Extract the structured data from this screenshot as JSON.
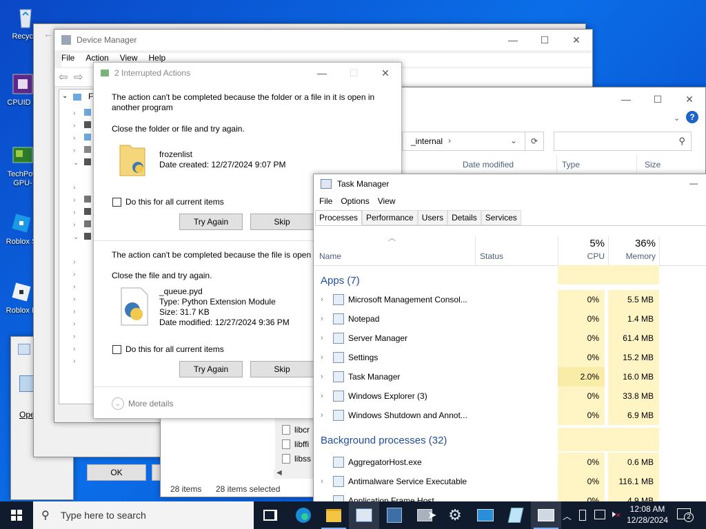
{
  "desktop": {
    "icons": [
      {
        "label": "Recycle",
        "icon": "recycle-bin-icon"
      },
      {
        "label": "CPUID C",
        "icon": "cpuid-icon"
      },
      {
        "label": "TechPow GPU-",
        "icon": "gpu-card-icon"
      },
      {
        "label": "Roblox S",
        "icon": "roblox-icon"
      },
      {
        "label": "Roblox P",
        "icon": "roblox-icon"
      }
    ]
  },
  "bg_window": {
    "open_label": "Ope"
  },
  "properties_window": {
    "ok_label": "OK"
  },
  "device_manager": {
    "title": "Device Manager",
    "menu": [
      "File",
      "Action",
      "View",
      "Help"
    ],
    "tree_root_letter": "F"
  },
  "explorer": {
    "path_text": "_internal",
    "search_placeholder": "",
    "columns": [
      "Date modified",
      "Type",
      "Size"
    ],
    "files": [
      "libcr",
      "libffi",
      "libss"
    ],
    "status_items": "28 items",
    "status_selected": "28 items selected"
  },
  "interrupted_dialog": {
    "title": "2 Interrupted Actions",
    "item1": {
      "message": "The action can't be completed because the folder or a file in it is open in another program",
      "instruction": "Close the folder or file and try again.",
      "name": "frozenlist",
      "detail1": "Date created: 12/27/2024 9:07 PM",
      "checkbox": "Do this for all current items",
      "try_again": "Try Again",
      "skip": "Skip"
    },
    "item2": {
      "message": "The action can't be completed because the file is open i",
      "instruction": "Close the file and try again.",
      "name": "_queue.pyd",
      "detail1": "Type: Python Extension Module",
      "detail2": "Size: 31.7 KB",
      "detail3": "Date modified: 12/27/2024 9:36 PM",
      "checkbox": "Do this for all current items",
      "try_again": "Try Again",
      "skip": "Skip"
    },
    "more_details": "More details"
  },
  "task_manager": {
    "title": "Task Manager",
    "menu": [
      "File",
      "Options",
      "View"
    ],
    "tabs": [
      "Processes",
      "Performance",
      "Users",
      "Details",
      "Services"
    ],
    "col_name": "Name",
    "col_status": "Status",
    "cpu_pct": "5%",
    "cpu_label": "CPU",
    "mem_pct": "36%",
    "mem_label": "Memory",
    "apps_header": "Apps (7)",
    "bg_header": "Background processes (32)",
    "apps": [
      {
        "name": "Microsoft Management Consol...",
        "cpu": "0%",
        "mem": "5.5 MB",
        "icon": "mmc-icon"
      },
      {
        "name": "Notepad",
        "cpu": "0%",
        "mem": "1.4 MB",
        "icon": "notepad-icon"
      },
      {
        "name": "Server Manager",
        "cpu": "0%",
        "mem": "61.4 MB",
        "icon": "server-manager-icon"
      },
      {
        "name": "Settings",
        "cpu": "0%",
        "mem": "15.2 MB",
        "icon": "settings-icon"
      },
      {
        "name": "Task Manager",
        "cpu": "2.0%",
        "mem": "16.0 MB",
        "icon": "task-manager-icon"
      },
      {
        "name": "Windows Explorer (3)",
        "cpu": "0%",
        "mem": "33.8 MB",
        "icon": "explorer-icon"
      },
      {
        "name": "Windows Shutdown and Annot...",
        "cpu": "0%",
        "mem": "6.9 MB",
        "icon": "shutdown-icon"
      }
    ],
    "bg": [
      {
        "name": "AggregatorHost.exe",
        "cpu": "0%",
        "mem": "0.6 MB",
        "icon": "process-icon"
      },
      {
        "name": "Antimalware Service Executable",
        "cpu": "0%",
        "mem": "116.1 MB",
        "icon": "process-icon"
      },
      {
        "name": "Application Frame Host",
        "cpu": "0%",
        "mem": "4.9 MB",
        "icon": "process-icon"
      }
    ]
  },
  "taskbar": {
    "search_placeholder": "Type here to search",
    "clock_time": "12:08 AM",
    "clock_date": "12/28/2024",
    "notification_count": "2"
  }
}
